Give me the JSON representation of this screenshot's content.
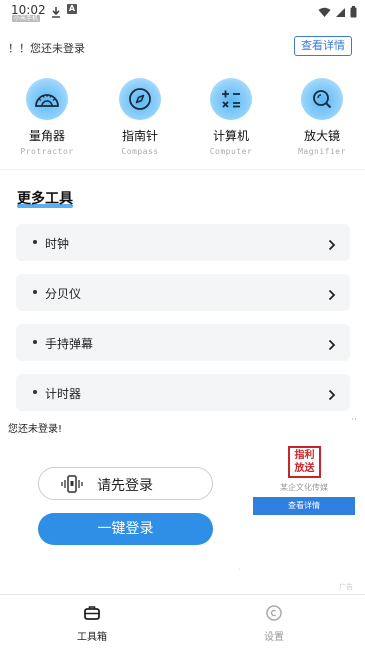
{
  "status_bar": {
    "time": "10:02",
    "sub_label": "小米手机"
  },
  "banner": {
    "text": "！！您还未登录",
    "detail_button": "查看详情"
  },
  "tools": [
    {
      "name": "量角器",
      "en": "Protractor",
      "icon": "protractor-icon"
    },
    {
      "name": "指南针",
      "en": "Compass",
      "icon": "compass-icon"
    },
    {
      "name": "计算机",
      "en": "Computer",
      "icon": "calculator-icon"
    },
    {
      "name": "放大镜",
      "en": "Magnifier",
      "icon": "magnifier-icon"
    }
  ],
  "more_tools": {
    "title": "更多工具",
    "items": [
      {
        "label": "时钟"
      },
      {
        "label": "分贝仪"
      },
      {
        "label": "手持弹幕"
      },
      {
        "label": "计时器"
      }
    ]
  },
  "ad": {
    "not_logged_in": "您还未登录!",
    "menu_dots": "··",
    "login_first": "请先登录",
    "one_click_login": "一键登录",
    "logo_text": "指利放送",
    "company": "某企文化传媒",
    "detail_button": "查看详情",
    "tag": "广告"
  },
  "bottom_nav": {
    "items": [
      {
        "label": "工具箱",
        "active": true
      },
      {
        "label": "设置",
        "active": false
      }
    ]
  },
  "colors": {
    "accent": "#2f8fe6",
    "banner_button": "#3a7bd5",
    "icon_circle": "#8fd0fa",
    "list_bg": "#f4f5f7",
    "nav_active": "#222222",
    "nav_inactive": "#999999"
  }
}
